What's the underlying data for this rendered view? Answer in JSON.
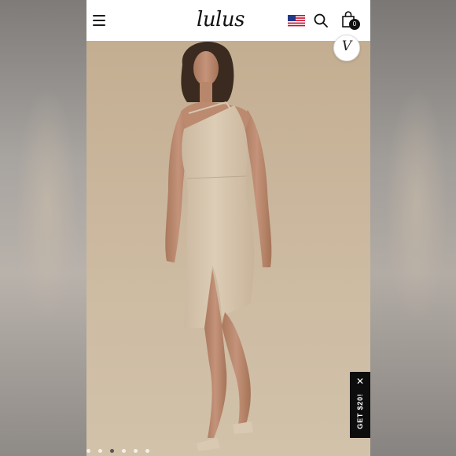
{
  "header": {
    "logo_text": "lulus",
    "cart_count": "0",
    "icons": [
      "menu-icon",
      "us-flag-icon",
      "search-icon",
      "shopping-bag-icon"
    ]
  },
  "product_image": {
    "description_icon": "product-photo",
    "carousel_total": 6,
    "carousel_active_index": 2
  },
  "wishlist": {
    "icon_text": "V"
  },
  "promo": {
    "label": "GET $20!",
    "close_icon": "close-icon"
  },
  "colors": {
    "background_beige": "#c7b59b",
    "dress_beige": "#d8c7b0",
    "header_bg": "#ffffff",
    "promo_bg": "#0d0d0d"
  }
}
